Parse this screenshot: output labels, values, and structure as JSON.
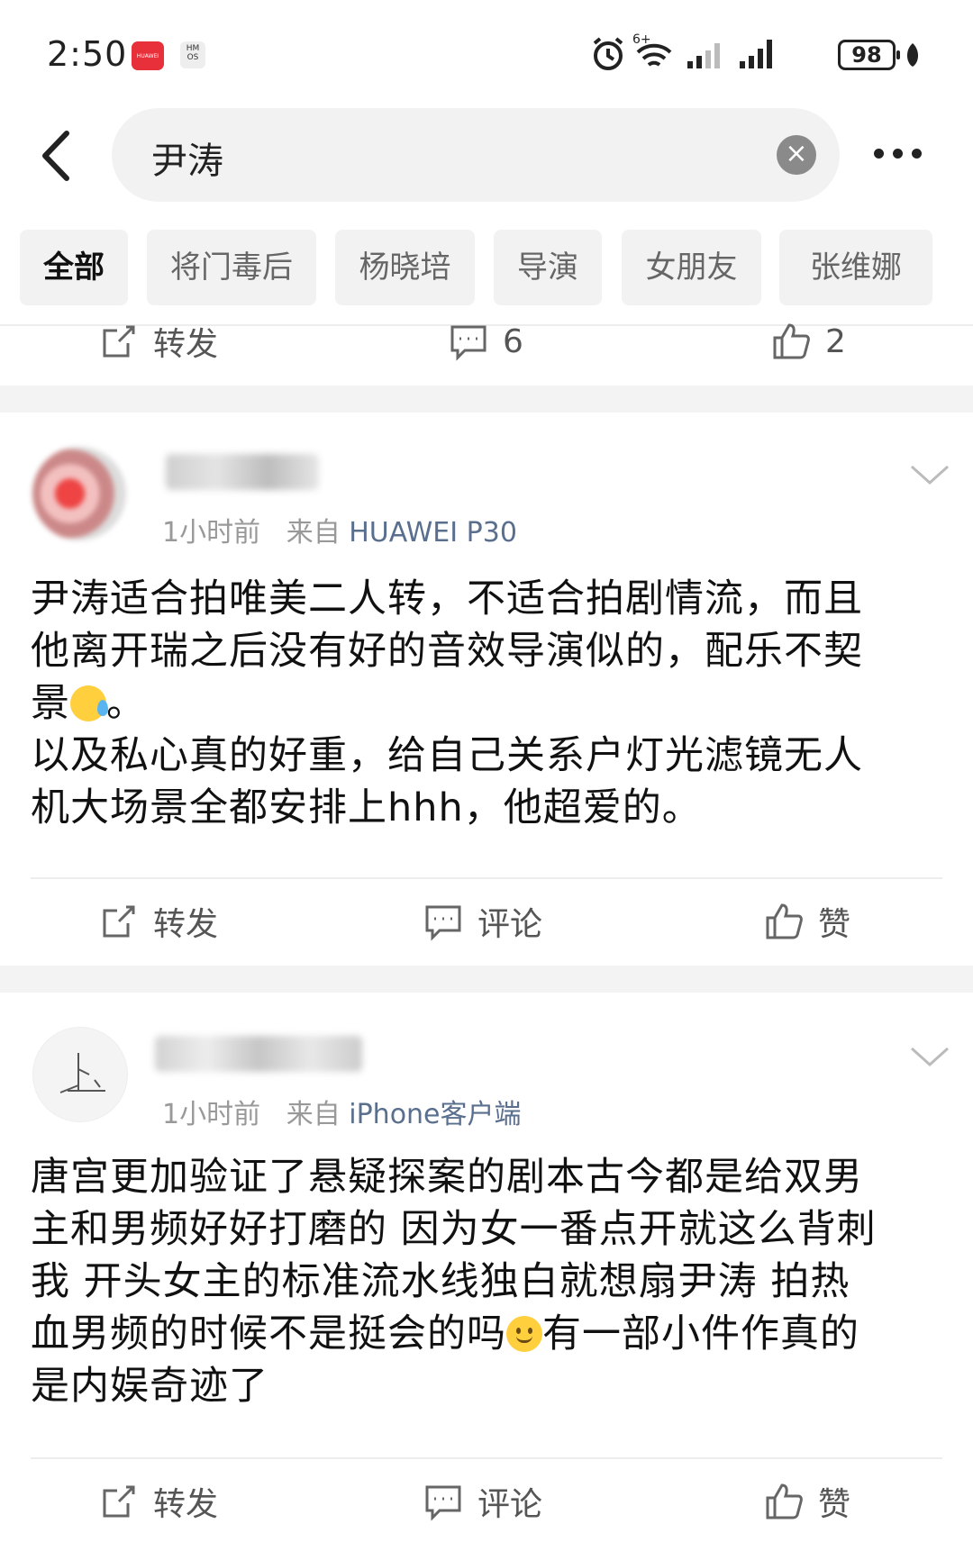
{
  "status_bar": {
    "time": "2:50",
    "app_badge_1": "HUAWEI",
    "app_badge_2": "HM OS",
    "icons": [
      "alarm-icon",
      "wifi-icon",
      "signal-icon",
      "signal-icon"
    ],
    "wifi_label": "6+",
    "battery": "98"
  },
  "search": {
    "query": "尹涛",
    "clear_icon": "×"
  },
  "chips": [
    {
      "label": "全部",
      "active": true
    },
    {
      "label": "将门毒后",
      "active": false
    },
    {
      "label": "杨晓培",
      "active": false
    },
    {
      "label": "导演",
      "active": false
    },
    {
      "label": "女朋友",
      "active": false
    },
    {
      "label": "张维娜",
      "active": false
    }
  ],
  "top_actions": {
    "repost": "转发",
    "comments": "6",
    "likes": "2"
  },
  "posts": [
    {
      "time": "1小时前",
      "from": "来自",
      "source": "HUAWEI P30",
      "lines": [
        "尹涛适合拍唯美二人转，不适合拍剧情流，而且",
        "他离开瑞之后没有好的音效导演似的，配乐不契",
        "景",
        "。",
        "以及私心真的好重，给自己关系户灯光滤镜无人",
        "机大场景全都安排上hhh，他超爱的。"
      ],
      "actions": {
        "repost": "转发",
        "comment": "评论",
        "like": "赞"
      }
    },
    {
      "time": "1小时前",
      "from": "来自",
      "source": "iPhone客户端",
      "lines": [
        "唐宫更加验证了悬疑探案的剧本古今都是给双男",
        "主和男频好好打磨的 因为女一番点开就这么背刺",
        "我 开头女主的标准流水线独白就想扇尹涛 拍热",
        "血男频的时候不是挺会的吗",
        "有一部小件作真的",
        "是内娱奇迹了"
      ],
      "actions": {
        "repost": "转发",
        "comment": "评论",
        "like": "赞"
      }
    }
  ],
  "colors": {
    "source_link": "#5a6f8e",
    "meta": "#999999",
    "band": "#f3f3f3",
    "chip_bg": "#f2f2f2"
  }
}
